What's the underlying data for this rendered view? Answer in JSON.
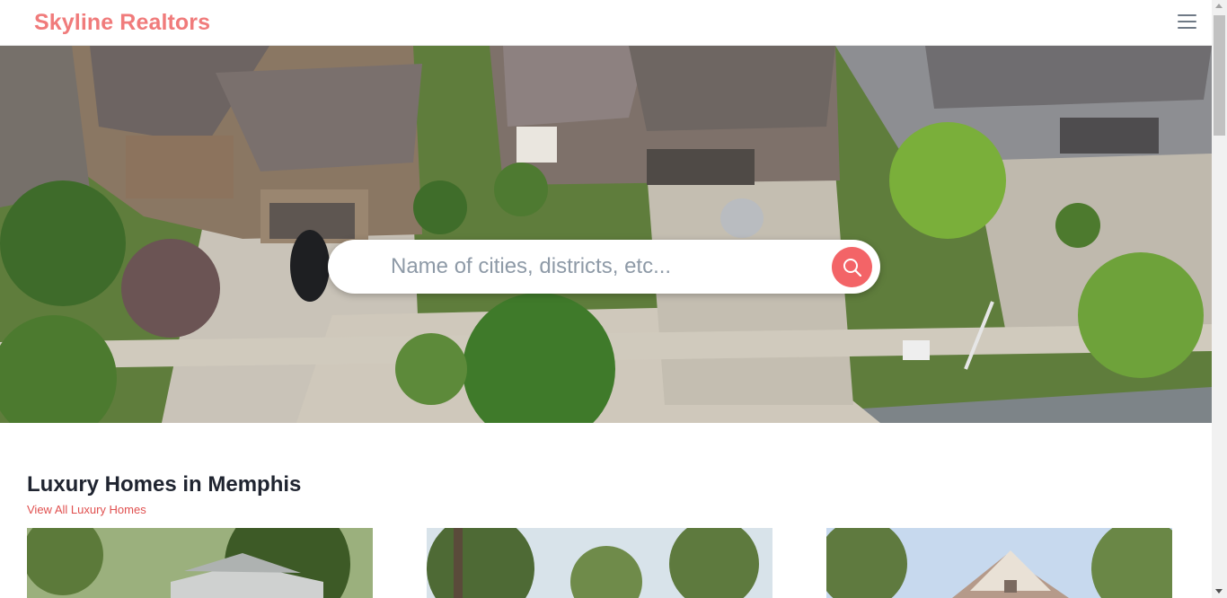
{
  "header": {
    "brand": "Skyline Realtors",
    "menu_icon": "hamburger-menu-icon"
  },
  "hero": {
    "search_placeholder": "Name of cities, districts, etc...",
    "search_icon": "search-icon"
  },
  "section": {
    "title": "Luxury Homes in Memphis",
    "view_all_label": "View All Luxury Homes"
  },
  "colors": {
    "brand": "#f07b7b",
    "accent": "#f36467",
    "link": "#e0504f",
    "heading": "#1f2430"
  }
}
